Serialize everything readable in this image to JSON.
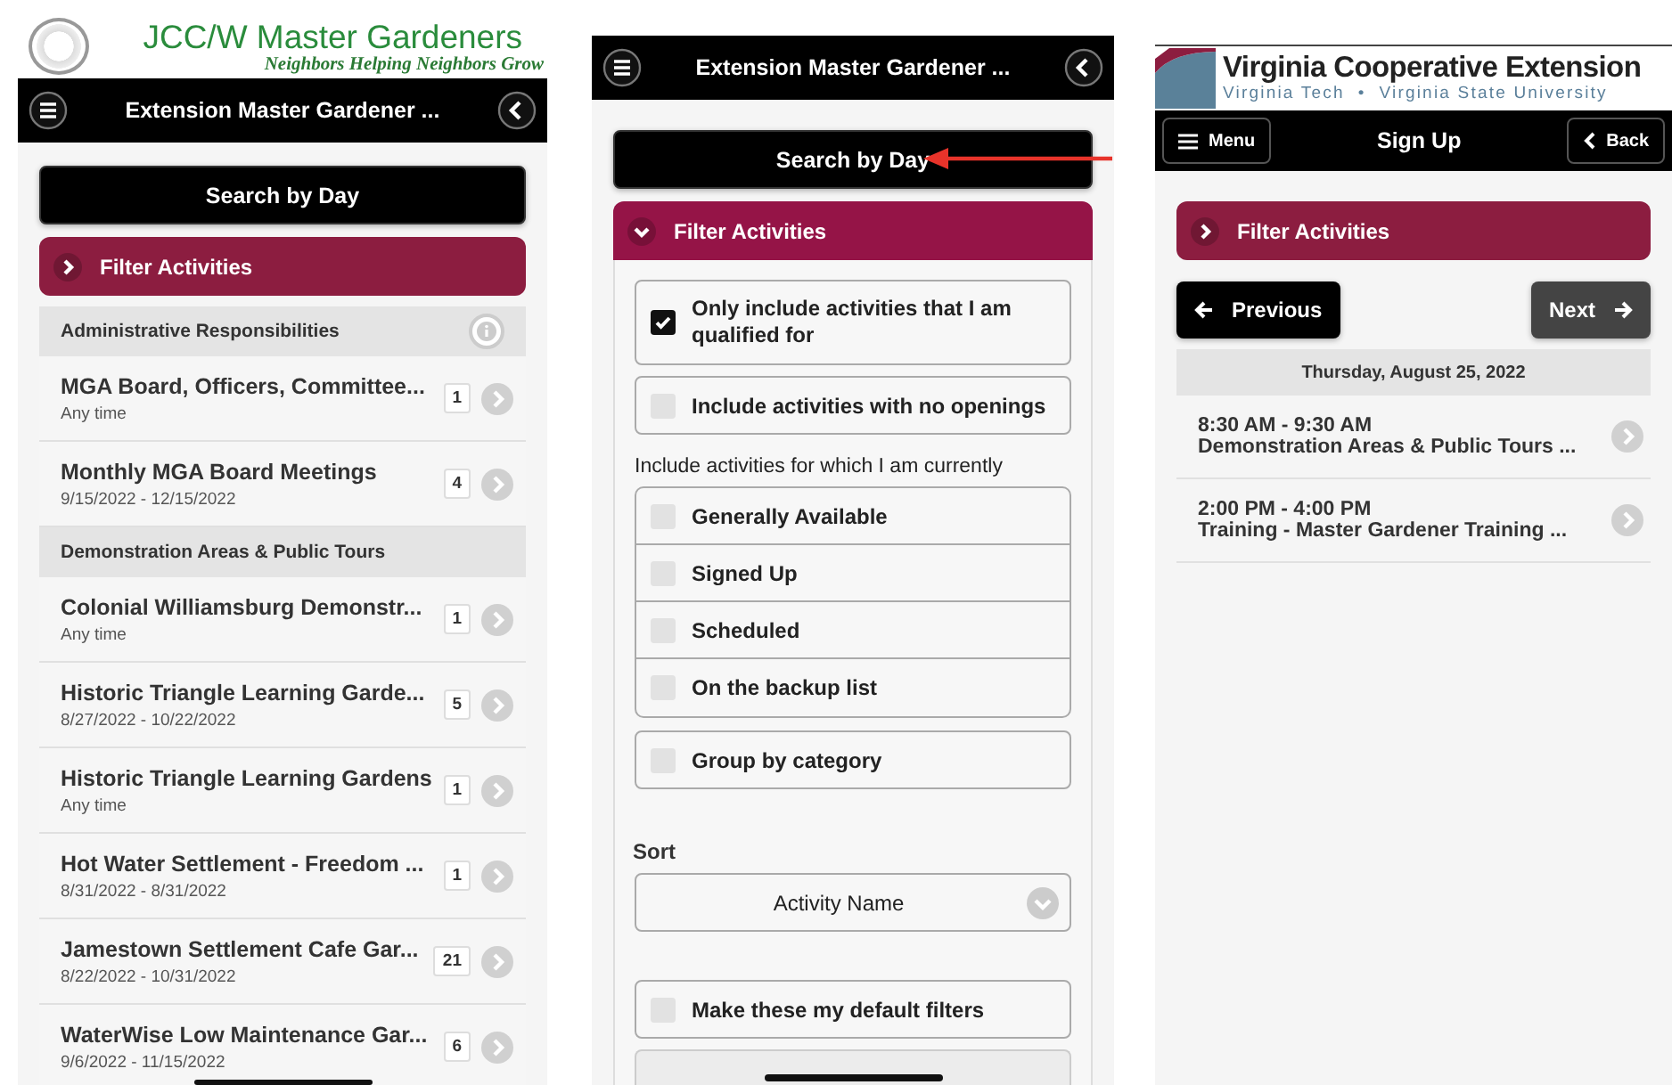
{
  "activities_screen": {
    "header": {
      "title": "JCC/W Master Gardeners",
      "tagline": "Neighbors Helping Neighbors Grow"
    },
    "nav": {
      "title": "Extension Master Gardener ..."
    },
    "search_button": "Search by Day",
    "filter": {
      "label": "Filter Activities",
      "expanded": false
    },
    "groups": [
      {
        "name": "Administrative Responsibilities",
        "info_icon": true,
        "items": [
          {
            "title": "MGA Board, Officers, Committee...",
            "dates": "Any time",
            "count": "1"
          },
          {
            "title": "Monthly MGA Board Meetings",
            "dates": "9/15/2022 - 12/15/2022",
            "count": "4"
          }
        ]
      },
      {
        "name": "Demonstration Areas & Public Tours",
        "info_icon": false,
        "items": [
          {
            "title": "Colonial Williamsburg Demonstr...",
            "dates": "Any time",
            "count": "1"
          },
          {
            "title": "Historic Triangle Learning Garde...",
            "dates": "8/27/2022 - 10/22/2022",
            "count": "5"
          },
          {
            "title": "Historic Triangle Learning Gardens",
            "dates": "Any time",
            "count": "1"
          },
          {
            "title": "Hot Water Settlement - Freedom ...",
            "dates": "8/31/2022 - 8/31/2022",
            "count": "1"
          },
          {
            "title": "Jamestown Settlement Cafe Gar...",
            "dates": "8/22/2022 - 10/31/2022",
            "count": "21"
          },
          {
            "title": "WaterWise Low Maintenance Gar...",
            "dates": "9/6/2022 - 11/15/2022",
            "count": "6"
          }
        ]
      }
    ]
  },
  "filter_screen": {
    "nav": {
      "title": "Extension Master Gardener ..."
    },
    "search_button": "Search by Day",
    "filter": {
      "label": "Filter Activities",
      "expanded": true
    },
    "options": [
      {
        "label": "Only include activities that I am qualified for",
        "checked": true
      },
      {
        "label": "Include activities with no openings",
        "checked": false
      }
    ],
    "currently_label": "Include activities for which I am currently",
    "status_options": [
      {
        "label": "Generally Available",
        "checked": false
      },
      {
        "label": "Signed Up",
        "checked": false
      },
      {
        "label": "Scheduled",
        "checked": false
      },
      {
        "label": "On the backup list",
        "checked": false
      }
    ],
    "group_option": {
      "label": "Group by category",
      "checked": false
    },
    "sort": {
      "label": "Sort",
      "value": "Activity Name"
    },
    "default_option": {
      "label": "Make these my default filters",
      "checked": false
    }
  },
  "signup_screen": {
    "header": {
      "title": "Virginia Cooperative Extension",
      "subtitle": "Virginia Tech  •  Virginia State University"
    },
    "nav": {
      "menu_button": "Menu",
      "title": "Sign Up",
      "back_button": "Back"
    },
    "filter": {
      "label": "Filter Activities",
      "expanded": false
    },
    "previous_button": "Previous",
    "next_button": "Next",
    "date_header": "Thursday, August 25, 2022",
    "slots": [
      {
        "time": "8:30 AM - 9:30 AM",
        "title": "Demonstration Areas & Public Tours ..."
      },
      {
        "time": "2:00 PM - 4:00 PM",
        "title": "Training - Master Gardener Training ..."
      }
    ]
  }
}
